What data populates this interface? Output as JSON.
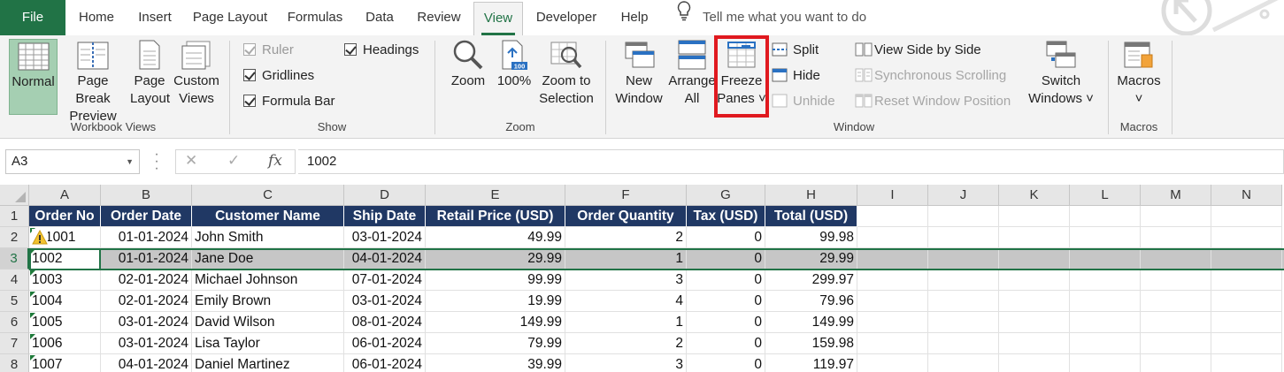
{
  "tabs": {
    "file": "File",
    "home": "Home",
    "insert": "Insert",
    "page_layout": "Page Layout",
    "formulas": "Formulas",
    "data": "Data",
    "review": "Review",
    "view": "View",
    "developer": "Developer",
    "help": "Help"
  },
  "tell_me": "Tell me what you want to do",
  "ribbon": {
    "workbook_views": {
      "label": "Workbook Views",
      "normal": "Normal",
      "page_break_1": "Page Break",
      "page_break_2": "Preview",
      "page_layout_1": "Page",
      "page_layout_2": "Layout",
      "custom_views_1": "Custom",
      "custom_views_2": "Views"
    },
    "show": {
      "label": "Show",
      "ruler": "Ruler",
      "gridlines": "Gridlines",
      "formula_bar": "Formula Bar",
      "headings": "Headings"
    },
    "zoom": {
      "label": "Zoom",
      "zoom": "Zoom",
      "hundred": "100%",
      "zoom_sel_1": "Zoom to",
      "zoom_sel_2": "Selection",
      "hundred_icon_text": "100"
    },
    "window": {
      "label": "Window",
      "new_window_1": "New",
      "new_window_2": "Window",
      "arrange_1": "Arrange",
      "arrange_2": "All",
      "freeze_1": "Freeze",
      "freeze_2": "Panes ˅",
      "split": "Split",
      "hide": "Hide",
      "unhide": "Unhide",
      "side_by_side": "View Side by Side",
      "sync_scroll": "Synchronous Scrolling",
      "reset_pos": "Reset Window Position",
      "switch_1": "Switch",
      "switch_2": "Windows ˅"
    },
    "macros": {
      "label": "Macros",
      "macros": "Macros",
      "arrow": "˅"
    }
  },
  "formula_bar": {
    "name_box": "A3",
    "value": "1002",
    "cancel": "✕",
    "enter": "✓",
    "fx": "fx"
  },
  "columns": [
    "A",
    "B",
    "C",
    "D",
    "E",
    "F",
    "G",
    "H",
    "I",
    "J",
    "K",
    "L",
    "M",
    "N"
  ],
  "rows": [
    "1",
    "2",
    "3",
    "4",
    "5",
    "6",
    "7",
    "8"
  ],
  "table": {
    "headers": [
      "Order No",
      "Order Date",
      "Customer Name",
      "Ship Date",
      "Retail Price (USD)",
      "Order Quantity",
      "Tax (USD)",
      "Total (USD)"
    ],
    "rows": [
      [
        "1001",
        "01-01-2024",
        "John Smith",
        "03-01-2024",
        "49.99",
        "2",
        "0",
        "99.98"
      ],
      [
        "1002",
        "01-01-2024",
        "Jane Doe",
        "04-01-2024",
        "29.99",
        "1",
        "0",
        "29.99"
      ],
      [
        "1003",
        "02-01-2024",
        "Michael Johnson",
        "07-01-2024",
        "99.99",
        "3",
        "0",
        "299.97"
      ],
      [
        "1004",
        "02-01-2024",
        "Emily Brown",
        "03-01-2024",
        "19.99",
        "4",
        "0",
        "79.96"
      ],
      [
        "1005",
        "03-01-2024",
        "David Wilson",
        "08-01-2024",
        "149.99",
        "1",
        "0",
        "149.99"
      ],
      [
        "1006",
        "03-01-2024",
        "Lisa Taylor",
        "06-01-2024",
        "79.99",
        "2",
        "0",
        "159.98"
      ],
      [
        "1007",
        "04-01-2024",
        "Daniel Martinez",
        "06-01-2024",
        "39.99",
        "3",
        "0",
        "119.97"
      ]
    ]
  },
  "colors": {
    "excel_green": "#217346",
    "header_navy": "#203864",
    "highlight_red": "#e0191f",
    "normal_selected": "#a5cfb2"
  }
}
